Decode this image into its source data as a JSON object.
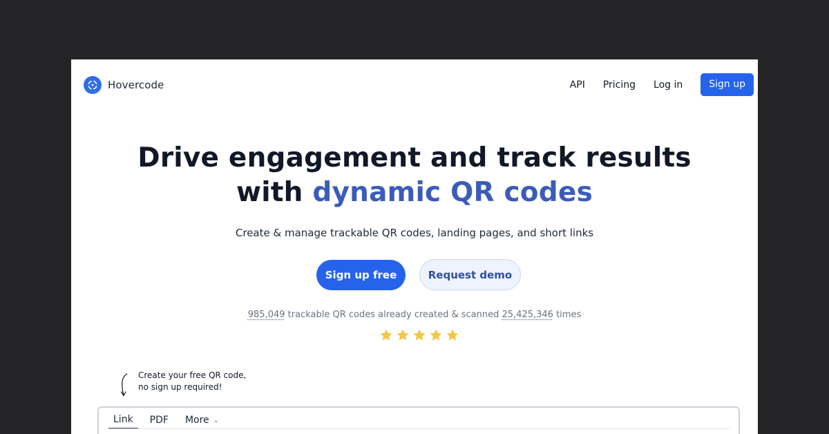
{
  "brand": {
    "name": "Hovercode",
    "accent": "#2563eb",
    "logo_icon": "hovercode-logo-icon"
  },
  "nav": {
    "links": [
      "API",
      "Pricing",
      "Log in"
    ],
    "signup_label": "Sign up"
  },
  "hero": {
    "title_line1": "Drive engagement and track results",
    "title_line2_prefix": "with",
    "title_line2_accent": "dynamic QR codes",
    "subtitle": "Create & manage trackable QR codes, landing pages, and short links",
    "primary_cta": "Sign up free",
    "secondary_cta": "Request demo"
  },
  "stats": {
    "codes_count": "985,049",
    "codes_text": "trackable QR codes already created & scanned",
    "scans_count": "25,425,346",
    "scans_text": "times",
    "rating_stars": 5,
    "star_color": "#f2c744"
  },
  "hint": {
    "text": "Create your free QR code, no sign up required!",
    "icon": "curved-arrow-down-icon"
  },
  "tool": {
    "tabs": [
      "Link",
      "PDF",
      "More"
    ],
    "active_tab": "Link",
    "more_icon": "chevron-down-icon"
  }
}
